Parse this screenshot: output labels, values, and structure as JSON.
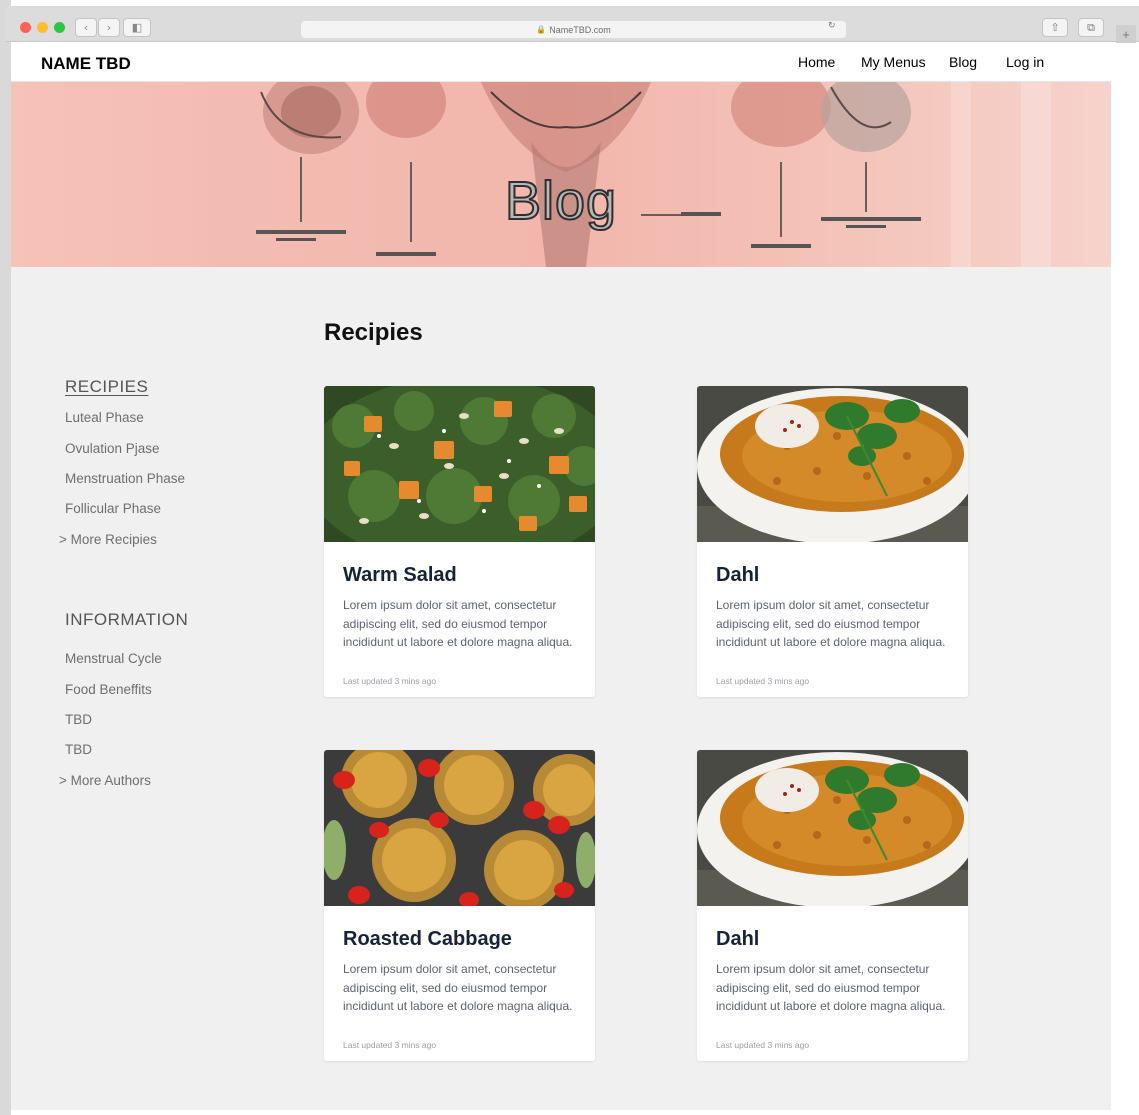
{
  "browser": {
    "url": "NameTBD.com",
    "back_icon": "chevron-left-icon",
    "forward_icon": "chevron-right-icon",
    "reload_icon": "reload-icon",
    "share_icon": "share-icon",
    "tabs_icon": "tabs-icon",
    "new_tab_icon": "plus-icon"
  },
  "header": {
    "logo": "NAME TBD",
    "nav": [
      "Home",
      "My Menus",
      "Blog",
      "Log in"
    ]
  },
  "hero": {
    "title": "Blog",
    "background": "#f3bcb2"
  },
  "sidebar": {
    "recipes_heading": "RECIPIES",
    "recipes_items": [
      "Luteal Phase",
      "Ovulation Pjase",
      "Menstruation Phase",
      "Follicular Phase",
      "> More Recipies"
    ],
    "info_heading": "INFORMATION",
    "info_items": [
      "Menstrual Cycle",
      "Food Beneffits",
      "TBD",
      "TBD",
      "> More Authors"
    ]
  },
  "main": {
    "section_title": "Recipies",
    "cards": [
      {
        "title": "Warm Salad",
        "image": "warm-salad-image",
        "description": "Lorem ipsum dolor sit amet, consectetur adipiscing elit, sed do eiusmod tempor incididunt ut labore et dolore magna aliqua.",
        "updated": "Last updated 3 mins ago"
      },
      {
        "title": "Dahl",
        "image": "dahl-image",
        "description": "Lorem ipsum dolor sit amet, consectetur adipiscing elit, sed do eiusmod tempor incididunt ut labore et dolore magna aliqua.",
        "updated": "Last updated 3 mins ago"
      },
      {
        "title": "Roasted Cabbage",
        "image": "roasted-cabbage-image",
        "description": "Lorem ipsum dolor sit amet, consectetur adipiscing elit, sed do eiusmod tempor incididunt ut labore et dolore magna aliqua.",
        "updated": "Last updated 3 mins ago"
      },
      {
        "title": "Dahl",
        "image": "dahl-image",
        "description": "Lorem ipsum dolor sit amet, consectetur adipiscing elit, sed do eiusmod tempor incididunt ut labore et dolore magna aliqua.",
        "updated": "Last updated 3 mins ago"
      }
    ]
  },
  "colors": {
    "content_bg": "#f0f0f0",
    "card_title": "#16223a",
    "card_text": "#5c6370",
    "window_close": "#fe5f57",
    "window_minimize": "#febc2e",
    "window_maximize": "#28c840"
  }
}
